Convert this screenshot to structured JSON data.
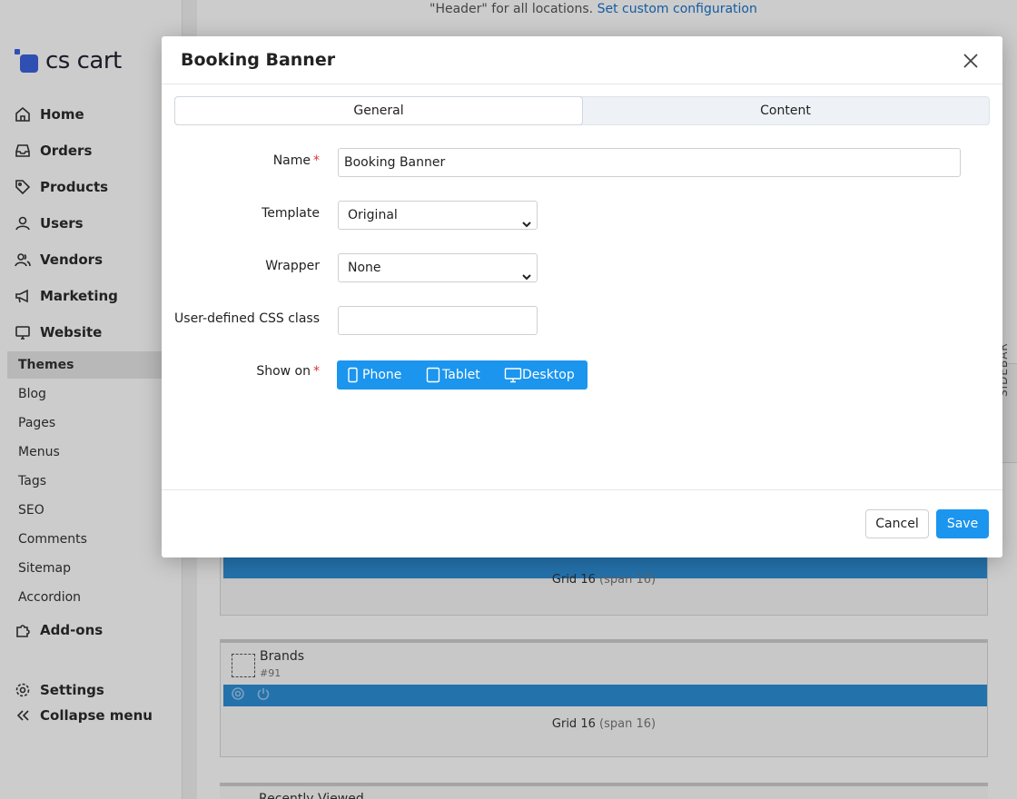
{
  "app": {
    "logo_text": "cs cart",
    "top_note_text": "\"Header\" for all locations.",
    "top_note_link": "Set custom configuration"
  },
  "sidebar": {
    "main_items": [
      {
        "label": "Home",
        "icon": "home-icon"
      },
      {
        "label": "Orders",
        "icon": "inbox-icon"
      },
      {
        "label": "Products",
        "icon": "tag-icon"
      },
      {
        "label": "Users",
        "icon": "user-icon"
      },
      {
        "label": "Vendors",
        "icon": "users-icon"
      },
      {
        "label": "Marketing",
        "icon": "megaphone-icon"
      },
      {
        "label": "Website",
        "icon": "monitor-icon"
      }
    ],
    "website_sub_items": [
      "Themes",
      "Blog",
      "Pages",
      "Menus",
      "Tags",
      "SEO",
      "Comments",
      "Sitemap",
      "Accordion"
    ],
    "active_sub_item": "Themes",
    "addons_label": "Add-ons",
    "settings_label": "Settings",
    "collapse_label": "Collapse menu"
  },
  "layout_blocks": {
    "grid_label_1": "Grid 16",
    "grid_span_1": "(span 16)",
    "brands_name": "Brands",
    "brands_id": "#91",
    "grid_label_2": "Grid 16",
    "grid_span_2": "(span 16)",
    "recent_name": "Recently Viewed",
    "side_tab_label": "SIDEBAR"
  },
  "dialog": {
    "title": "Booking Banner",
    "tabs": [
      {
        "label": "General",
        "active": true
      },
      {
        "label": "Content",
        "active": false
      }
    ],
    "fields": {
      "name_label": "Name",
      "name_value": "Booking Banner",
      "template_label": "Template",
      "template_value": "Original",
      "wrapper_label": "Wrapper",
      "wrapper_value": "None",
      "css_label": "User-defined CSS class",
      "css_value": "",
      "show_on_label": "Show on",
      "devices": [
        "Phone",
        "Tablet",
        "Desktop"
      ]
    },
    "cancel_label": "Cancel",
    "save_label": "Save"
  },
  "colors": {
    "accent": "#1b95ee",
    "required": "#dd3333",
    "logo": "#3d63e0"
  }
}
